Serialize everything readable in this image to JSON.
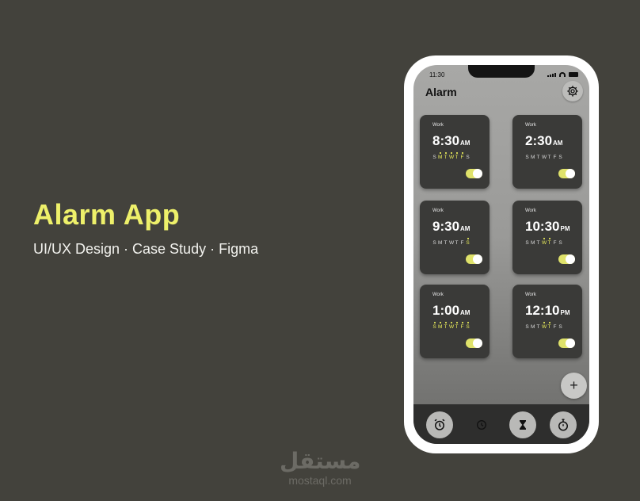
{
  "hero": {
    "title": "Alarm App",
    "subtitle": "UI/UX Design · Case Study · Figma"
  },
  "watermark": {
    "arabic": "مستقل",
    "domain": "mostaql.com"
  },
  "phone": {
    "status_time": "11:30",
    "app_title": "Alarm",
    "settings_icon": "gear-icon",
    "fab_label": "+",
    "alarms": [
      {
        "label": "Work",
        "time": "8:30",
        "period": "AM",
        "days": [
          "S",
          "M",
          "T",
          "W",
          "T",
          "F",
          "S"
        ],
        "active_days": [
          1,
          2,
          3,
          4,
          5
        ],
        "enabled": true
      },
      {
        "label": "Work",
        "time": "2:30",
        "period": "AM",
        "days": [
          "S",
          "M",
          "T",
          "W",
          "T",
          "F",
          "S"
        ],
        "active_days": [],
        "enabled": true
      },
      {
        "label": "Work",
        "time": "9:30",
        "period": "AM",
        "days": [
          "S",
          "M",
          "T",
          "W",
          "T",
          "F",
          "S"
        ],
        "active_days": [
          6
        ],
        "enabled": true
      },
      {
        "label": "Work",
        "time": "10:30",
        "period": "PM",
        "days": [
          "S",
          "M",
          "T",
          "W",
          "T",
          "F",
          "S"
        ],
        "active_days": [
          3,
          4
        ],
        "enabled": true
      },
      {
        "label": "Work",
        "time": "1:00",
        "period": "AM",
        "days": [
          "S",
          "M",
          "T",
          "W",
          "T",
          "F",
          "S"
        ],
        "active_days": [
          0,
          1,
          2,
          3,
          4,
          5,
          6
        ],
        "enabled": true
      },
      {
        "label": "Work",
        "time": "12:10",
        "period": "PM",
        "days": [
          "S",
          "M",
          "T",
          "W",
          "T",
          "F",
          "S"
        ],
        "active_days": [
          3,
          4
        ],
        "enabled": true
      }
    ],
    "nav": [
      {
        "name": "alarm-tab",
        "icon": "alarm-clock-icon",
        "active": true
      },
      {
        "name": "clock-tab",
        "icon": "clock-icon",
        "active": false
      },
      {
        "name": "timer-tab",
        "icon": "hourglass-icon",
        "active": true
      },
      {
        "name": "stopwatch-tab",
        "icon": "stopwatch-icon",
        "active": true
      }
    ]
  },
  "colors": {
    "background": "#43423c",
    "accent": "#eef06a",
    "card": "#3a3a38"
  }
}
